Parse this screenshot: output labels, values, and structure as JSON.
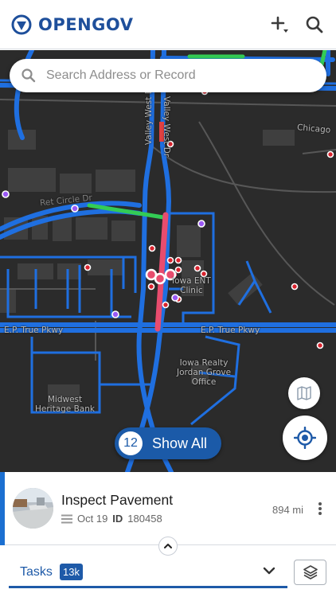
{
  "header": {
    "brand": "OPENGOV",
    "brand_color": "#1e4f9b",
    "actions": [
      {
        "name": "add-icon",
        "label": "+"
      },
      {
        "name": "search-icon"
      }
    ]
  },
  "search": {
    "placeholder": "Search Address or Record"
  },
  "map": {
    "labels": {
      "valley_west_dr_1": "Valley West Dr",
      "valley_west_dr_2": "Valley West Dr",
      "chicago": "Chicago",
      "ep_true_pkwy_left": "E.P. True Pkwy",
      "ep_true_pkwy_right": "E.P. True Pkwy",
      "ent_clinic": "Iowa ENT\nClinic",
      "iowa_realty": "Iowa Realty\nJordan Grove\nOffice",
      "midwest_bank": "Midwest\nHeritage Bank",
      "unnamed_street": "Ret Circle Dr"
    },
    "colors": {
      "road": "#1f6fe0",
      "highlight": "#33cc55",
      "route": "#e84c6e",
      "marker_red": "#d9232e",
      "marker_purple": "#9b59f6"
    }
  },
  "show_all": {
    "count": "12",
    "label": "Show All"
  },
  "record": {
    "title": "Inspect Pavement",
    "date": "Oct 19",
    "id_label": "ID",
    "id_value": "180458",
    "distance": "894 mi"
  },
  "footer": {
    "tasks_label": "Tasks",
    "tasks_count": "13k"
  }
}
